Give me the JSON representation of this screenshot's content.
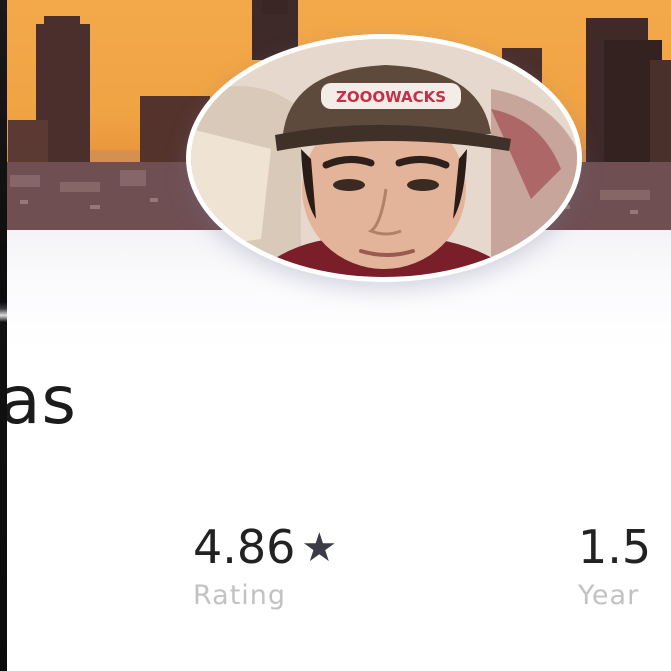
{
  "profile": {
    "name_visible": "as",
    "hat_text": "ZOOOWACKS"
  },
  "stats": {
    "rating": {
      "value": "4.86",
      "label": "Rating",
      "icon": "star-icon"
    },
    "years": {
      "value": "1.5",
      "label": "Year"
    }
  },
  "colors": {
    "banner_top": "#f3a94a",
    "banner_bottom": "#7a5a5a",
    "star": "#3b3b48",
    "label_gray": "#c2c2c2",
    "text_dark": "#1b1b1b"
  }
}
